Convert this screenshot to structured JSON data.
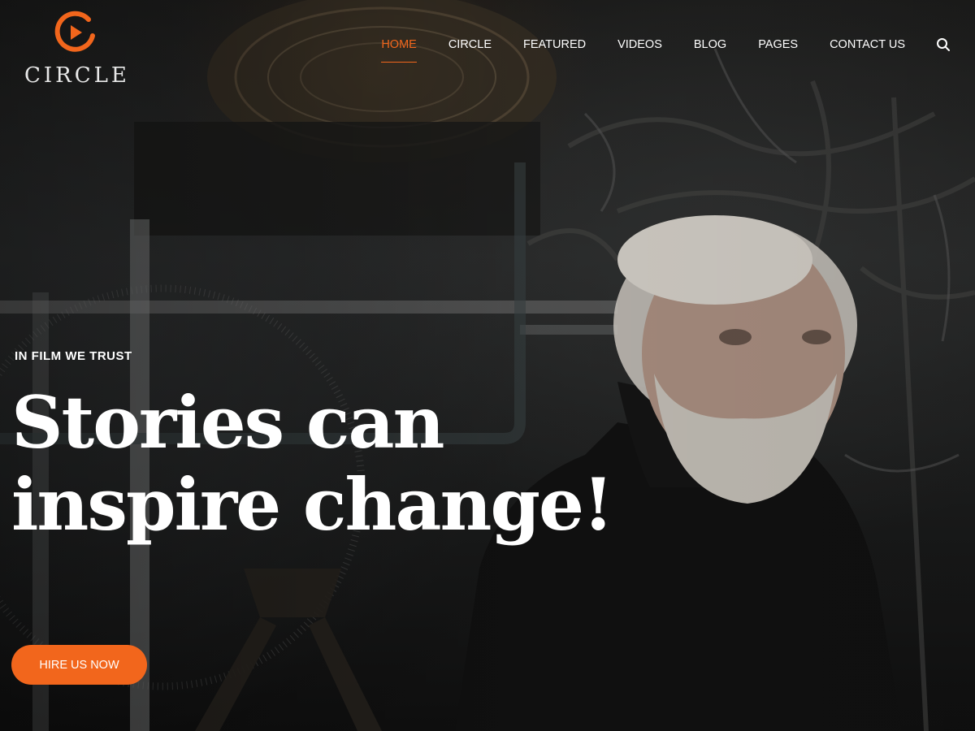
{
  "brand": {
    "name": "CIRCLE",
    "accent_color": "#f2661c",
    "logo_icon": "play-circle-icon"
  },
  "nav": {
    "items": [
      {
        "label": "HOME",
        "active": true
      },
      {
        "label": "CIRCLE",
        "active": false
      },
      {
        "label": "FEATURED",
        "active": false
      },
      {
        "label": "VIDEOS",
        "active": false
      },
      {
        "label": "BLOG",
        "active": false
      },
      {
        "label": "PAGES",
        "active": false
      },
      {
        "label": "CONTACT US",
        "active": false
      }
    ],
    "search_icon": "search-icon"
  },
  "hero": {
    "eyebrow": "IN FILM WE TRUST",
    "headline_line1": "Stories can",
    "headline_line2": "inspire change!",
    "cta_label": "HIRE US NOW",
    "background": "cinematic-still-elderly-man"
  }
}
